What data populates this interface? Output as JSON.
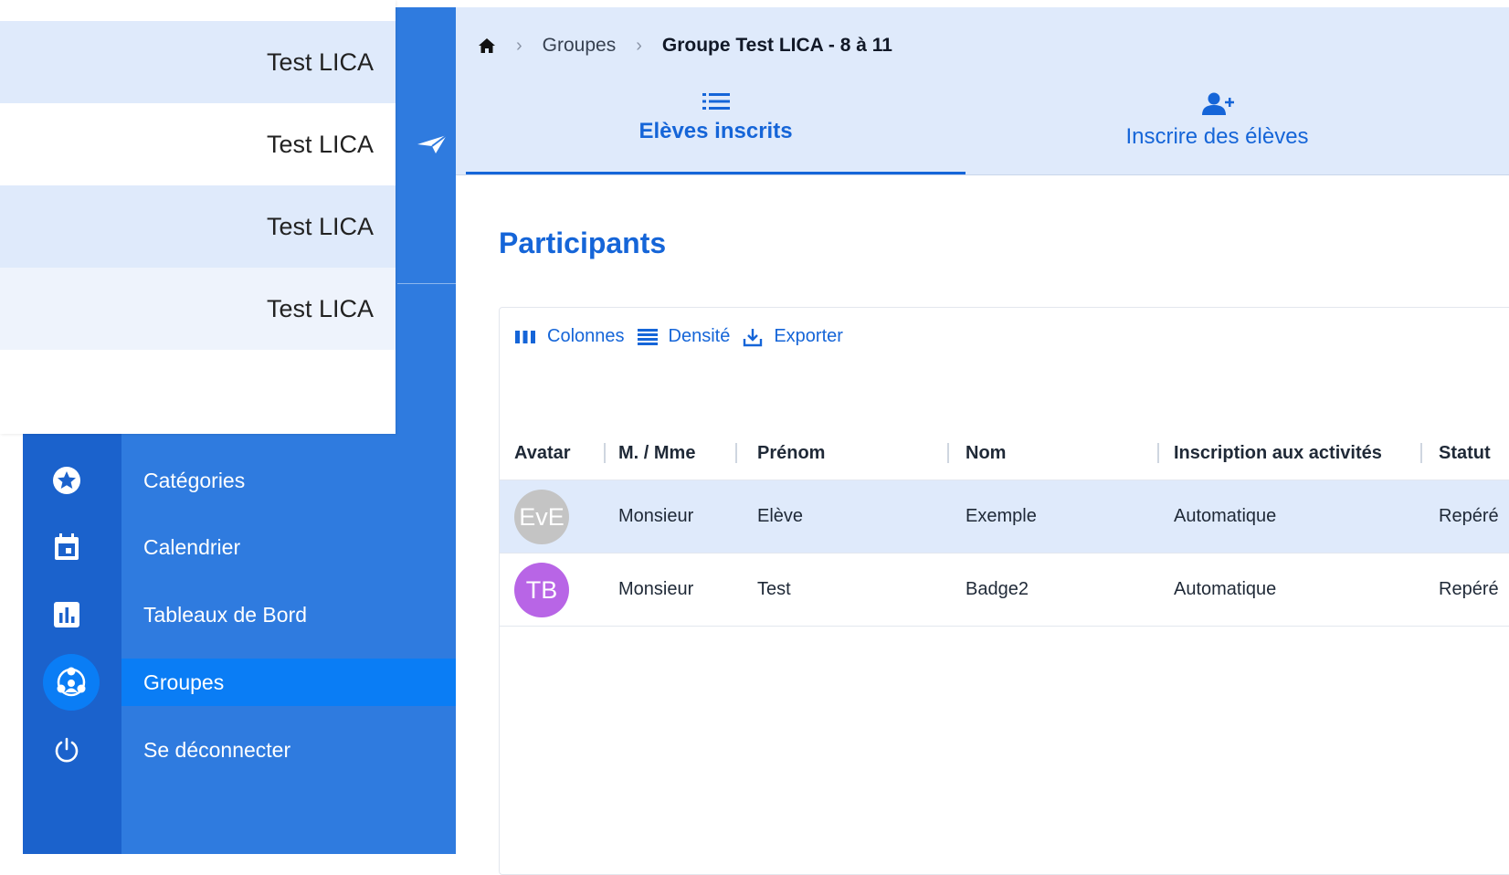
{
  "overlay_list": {
    "items": [
      "Test LICA",
      "Test LICA",
      "Test LICA",
      "Test LICA"
    ],
    "row_backgrounds": [
      "#dfeafb",
      "#ffffff",
      "#dfeafb",
      "#eef3fc"
    ]
  },
  "sidebar": {
    "background": "#2f7bdf",
    "icon_column_background": "#1b62cc",
    "active_color": "#0a7df5",
    "items": [
      {
        "label": "Catégories",
        "icon": "star-badge-icon"
      },
      {
        "label": "Calendrier",
        "icon": "calendar-icon"
      },
      {
        "label": "Tableaux de Bord",
        "icon": "bar-chart-icon"
      },
      {
        "label": "Groupes",
        "icon": "group-icon",
        "active": true
      },
      {
        "label": "Se déconnecter",
        "icon": "power-icon"
      }
    ]
  },
  "breadcrumb": {
    "home_icon": "home-icon",
    "items": [
      "Groupes",
      "Groupe Test LICA - 8 à 11"
    ]
  },
  "tabs": [
    {
      "label": "Elèves inscrits",
      "icon": "list-icon",
      "active": true
    },
    {
      "label": "Inscrire des élèves",
      "icon": "person-add-icon",
      "active": false
    }
  ],
  "page": {
    "title": "Participants"
  },
  "toolbar": {
    "columns_label": "Colonnes",
    "density_label": "Densité",
    "export_label": "Exporter"
  },
  "table": {
    "columns": [
      "Avatar",
      "M. / Mme",
      "Prénom",
      "Nom",
      "Inscription aux activités",
      "Statut"
    ],
    "rows": [
      {
        "initials": "EvE",
        "avatar_color": "#c4c4c4",
        "civilite": "Monsieur",
        "prenom": "Elève",
        "nom": "Exemple",
        "inscription": "Automatique",
        "statut": "Repéré",
        "selected": true
      },
      {
        "initials": "TB",
        "avatar_color": "#b865e6",
        "civilite": "Monsieur",
        "prenom": "Test",
        "nom": "Badge2",
        "inscription": "Automatique",
        "statut": "Repéré",
        "selected": false
      }
    ]
  },
  "colors": {
    "primary": "#1565d8",
    "light_band": "#dfeafb"
  }
}
